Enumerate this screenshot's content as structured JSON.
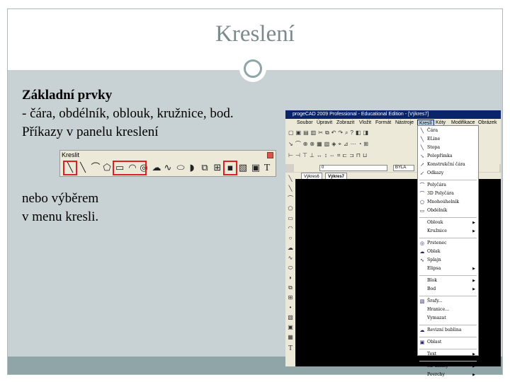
{
  "slide": {
    "title": "Kreslení",
    "heading": "Základní prvky",
    "line1": "- čára, obdélník, oblouk, kružnice, bod.",
    "line2": "Příkazy v panelu kreslení",
    "line3": "nebo výběrem",
    "line4": "v menu kresli."
  },
  "toolbar": {
    "title": "Kreslit",
    "icons": [
      "line-icon",
      "construction-line-icon",
      "polyline-icon",
      "polygon-icon",
      "rectangle-icon",
      "arc-icon",
      "circle-icon",
      "revision-cloud-icon",
      "spline-icon",
      "ellipse-icon",
      "ellipse-arc-icon",
      "insert-block-icon",
      "make-block-icon",
      "point-icon",
      "hatch-icon",
      "region-icon",
      "text-icon"
    ],
    "text_glyph": "T"
  },
  "cad": {
    "title": "progeCAD 2009 Professional - Educational Edition - [Výkres7]",
    "menus": [
      "Soubor",
      "Úpravit",
      "Zobrazit",
      "Vložit",
      "Formát",
      "Nástroje",
      "Kreslí",
      "Kóty",
      "Modifikace",
      "Obrázek"
    ],
    "active_menu": "Kreslí",
    "tabs": [
      "Výkres6",
      "Výkres7"
    ],
    "layer_value": "0",
    "color_value": "BYLA"
  },
  "dropdown": {
    "items": [
      {
        "label": "Čára",
        "icon": "line-icon",
        "submenu": false
      },
      {
        "label": "ELine",
        "icon": "eline-icon",
        "submenu": false
      },
      {
        "label": "Stopa",
        "icon": "trace-icon",
        "submenu": false
      },
      {
        "label": "Polopřímka",
        "icon": "ray-icon",
        "submenu": false
      },
      {
        "label": "Konstrukční čára",
        "icon": "construction-line-icon",
        "submenu": false
      },
      {
        "label": "Odkazy",
        "icon": "leader-icon",
        "submenu": false
      },
      {
        "label": "Polyčára",
        "icon": "polyline-icon",
        "submenu": false
      },
      {
        "label": "3D Polyčára",
        "icon": "3d-polyline-icon",
        "submenu": false
      },
      {
        "label": "Mnohoúhelník",
        "icon": "polygon-icon",
        "submenu": false
      },
      {
        "label": "Obdélník",
        "icon": "rectangle-icon",
        "submenu": false
      },
      {
        "label": "Oblouk",
        "icon": "arc-icon",
        "submenu": true
      },
      {
        "label": "Kružnice",
        "icon": "circle-icon",
        "submenu": true
      },
      {
        "label": "Prstenec",
        "icon": "donut-icon",
        "submenu": false
      },
      {
        "label": "Oblak",
        "icon": "cloud-icon",
        "submenu": false
      },
      {
        "label": "Splajn",
        "icon": "spline-icon",
        "submenu": false
      },
      {
        "label": "Elipsa",
        "icon": "ellipse-icon",
        "submenu": true
      },
      {
        "label": "Blok",
        "icon": "block-icon",
        "submenu": true
      },
      {
        "label": "Bod",
        "icon": "point-icon",
        "submenu": true
      },
      {
        "label": "Šrafy...",
        "icon": "hatch-icon",
        "submenu": false
      },
      {
        "label": "Hranice...",
        "icon": "boundary-icon",
        "submenu": false
      },
      {
        "label": "Vymazat",
        "icon": "wipeout-icon",
        "submenu": false
      },
      {
        "label": "Revizní bublina",
        "icon": "revision-cloud-icon",
        "submenu": false
      },
      {
        "label": "Oblast",
        "icon": "region-icon",
        "submenu": false
      },
      {
        "label": "Text",
        "icon": "text-icon",
        "submenu": true
      },
      {
        "label": "3D Entity",
        "icon": "3d-entity-icon",
        "submenu": true
      },
      {
        "label": "Povrchy",
        "icon": "surfaces-icon",
        "submenu": true
      }
    ]
  }
}
